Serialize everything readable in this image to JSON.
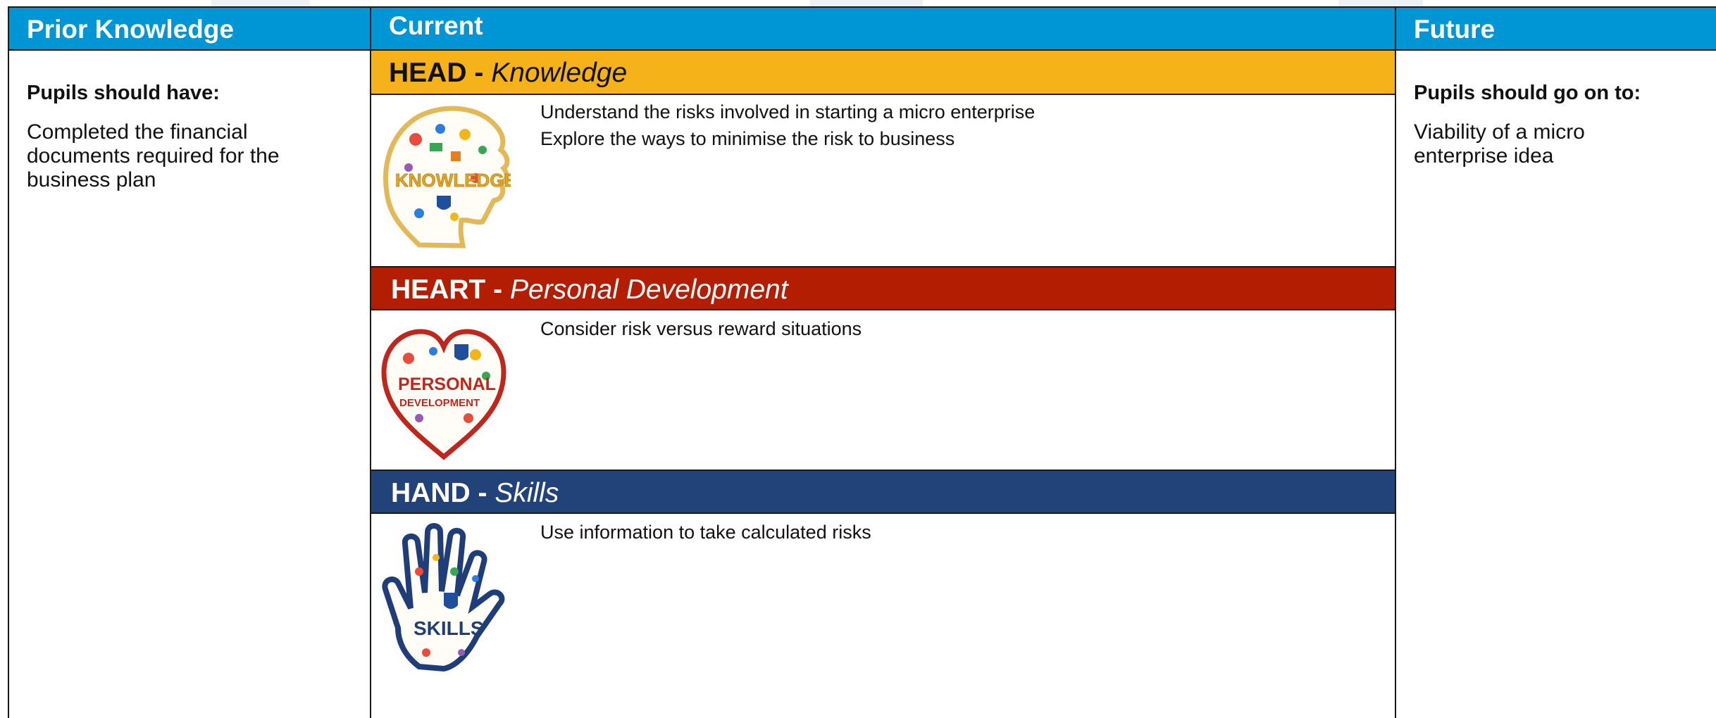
{
  "columns": {
    "prior": {
      "header": "Prior Knowledge",
      "heading": "Pupils should have:",
      "text": "Completed the financial  documents required for the business plan"
    },
    "current": {
      "header": "Current"
    },
    "future": {
      "header": "Future",
      "heading": "Pupils should go on to:",
      "text": "Viability of a micro enterprise idea"
    }
  },
  "sections": {
    "head": {
      "label_strong": "HEAD -",
      "label_em": "Knowledge",
      "image_word": "KNOWLEDGE",
      "points": [
        "Understand the risks involved in starting a micro enterprise",
        "Explore the ways to minimise the risk to business"
      ]
    },
    "heart": {
      "label_strong": "HEART -",
      "label_em": "Personal Development",
      "image_word_1": "PERSONAL",
      "image_word_2": "DEVELOPMENT",
      "points": [
        "Consider risk versus reward situations"
      ]
    },
    "hand": {
      "label_strong": "HAND -",
      "label_em": "Skills",
      "image_word": "SKILLS",
      "points": [
        "Use information to take calculated risks"
      ]
    }
  },
  "colors": {
    "header_blue": "#0096d6",
    "head_band": "#f5b219",
    "heart_band": "#b31e02",
    "hand_band": "#22427a"
  },
  "icons": {
    "head_image": "knowledge-head-icon",
    "heart_image": "personal-development-heart-icon",
    "hand_image": "skills-hand-icon"
  }
}
